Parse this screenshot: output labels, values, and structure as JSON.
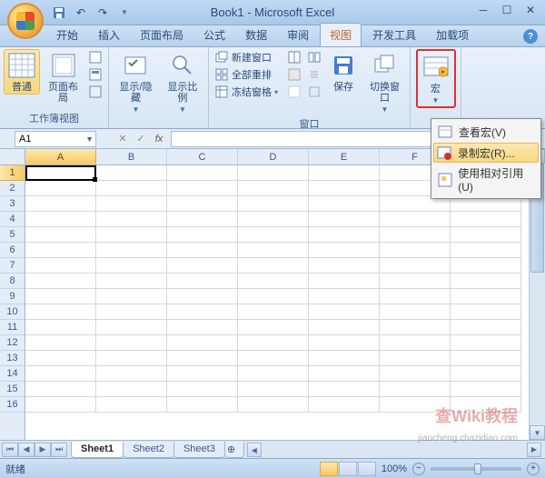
{
  "title": "Book1 - Microsoft Excel",
  "qat": {
    "save": "💾",
    "undo": "↶",
    "redo": "↷"
  },
  "tabs": [
    "开始",
    "插入",
    "页面布局",
    "公式",
    "数据",
    "审阅",
    "视图",
    "开发工具",
    "加载项"
  ],
  "active_tab_index": 6,
  "ribbon": {
    "group1": {
      "label": "工作簿视图",
      "normal": "普通",
      "page_layout": "页面布局"
    },
    "group2": {
      "show_hide": "显示/隐藏",
      "zoom": "显示比例"
    },
    "group3": {
      "label": "窗口",
      "new_window": "新建窗口",
      "arrange_all": "全部重排",
      "freeze": "冻结窗格",
      "save_ws": "保存",
      "switch": "切换窗口"
    },
    "group4": {
      "macro": "宏"
    }
  },
  "dropdown": {
    "view_macro": "查看宏(V)",
    "record_macro": "录制宏(R)...",
    "relative_ref": "使用相对引用(U)"
  },
  "namebox": "A1",
  "fx": "fx",
  "columns": [
    "A",
    "B",
    "C",
    "D",
    "E",
    "F"
  ],
  "rows": [
    "1",
    "2",
    "3",
    "4",
    "5",
    "6",
    "7",
    "8",
    "9",
    "10",
    "11",
    "12",
    "13",
    "14",
    "15",
    "16"
  ],
  "sheets": [
    "Sheet1",
    "Sheet2",
    "Sheet3"
  ],
  "active_sheet": 0,
  "status": "就绪",
  "zoom": "100%",
  "watermark": "查Wiki教程",
  "watermark2": "jiaocheng.chazidian.com"
}
